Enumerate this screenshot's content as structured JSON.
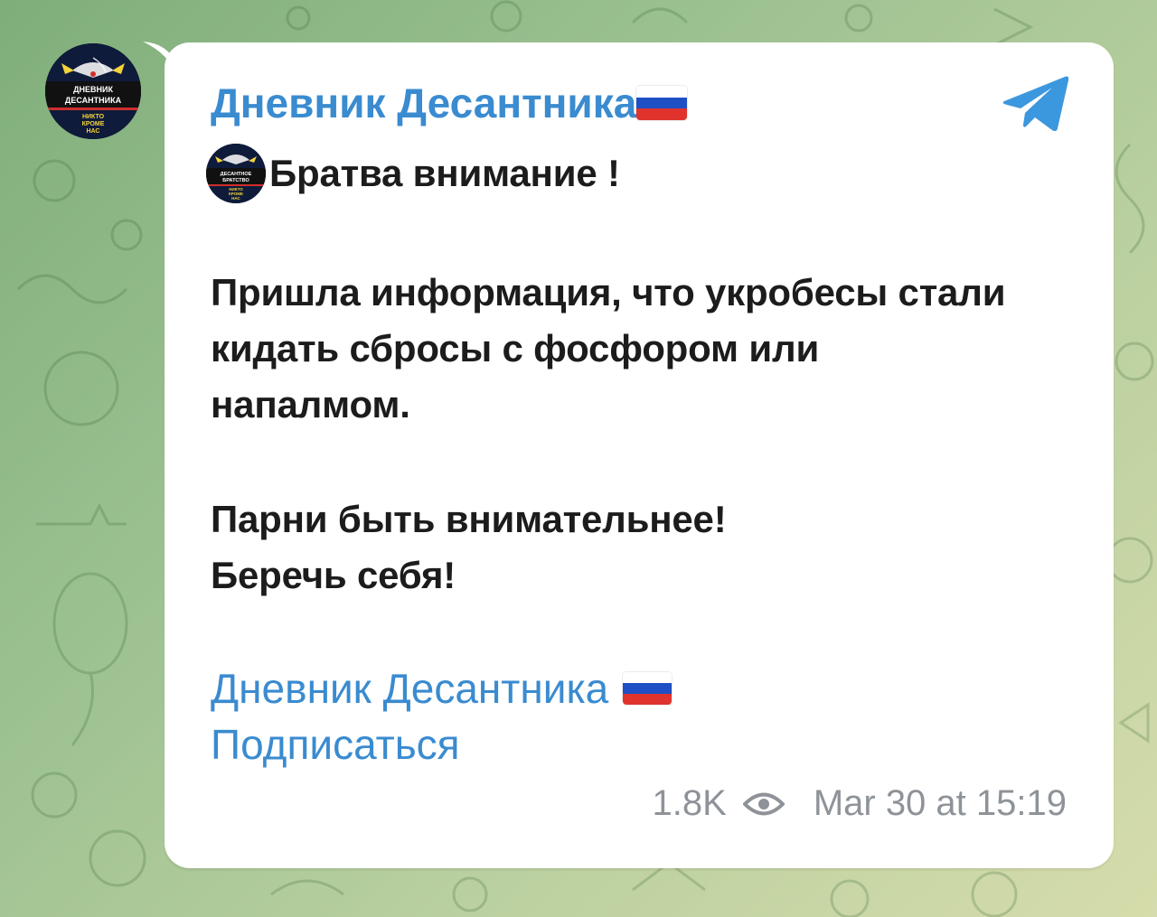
{
  "channel": {
    "title": "Дневник Десантника",
    "avatar_lines": [
      "ДНЕВНИК",
      "ДЕСАНТНИКА"
    ],
    "avatar_motto": [
      "НИКТО",
      "КРОМЕ",
      "НАС"
    ]
  },
  "message": {
    "line1": "Братва внимание !",
    "mini_logo_lines": [
      "ДЕСАНТНОЕ",
      "БРАТСТВО"
    ],
    "mini_logo_motto": [
      "НИКТО",
      "КРОМЕ",
      "НАС"
    ],
    "paragraph1": [
      "Пришла информация, что укробесы стали",
      "кидать сбросы с фосфором или",
      "напалмом."
    ],
    "paragraph2": [
      "Парни быть внимательнее!",
      "Беречь себя!"
    ],
    "signature_link": "Дневник Десантника",
    "subscribe_link": "Подписаться"
  },
  "footer": {
    "views": "1.8K",
    "timestamp": "Mar 30 at 15:19"
  },
  "icons": {
    "app": "telegram-icon",
    "views": "eye-icon",
    "flag": "russia-flag-icon"
  },
  "colors": {
    "link": "#3a8bd0",
    "text": "#1c1c1c",
    "meta": "#8e9399"
  }
}
